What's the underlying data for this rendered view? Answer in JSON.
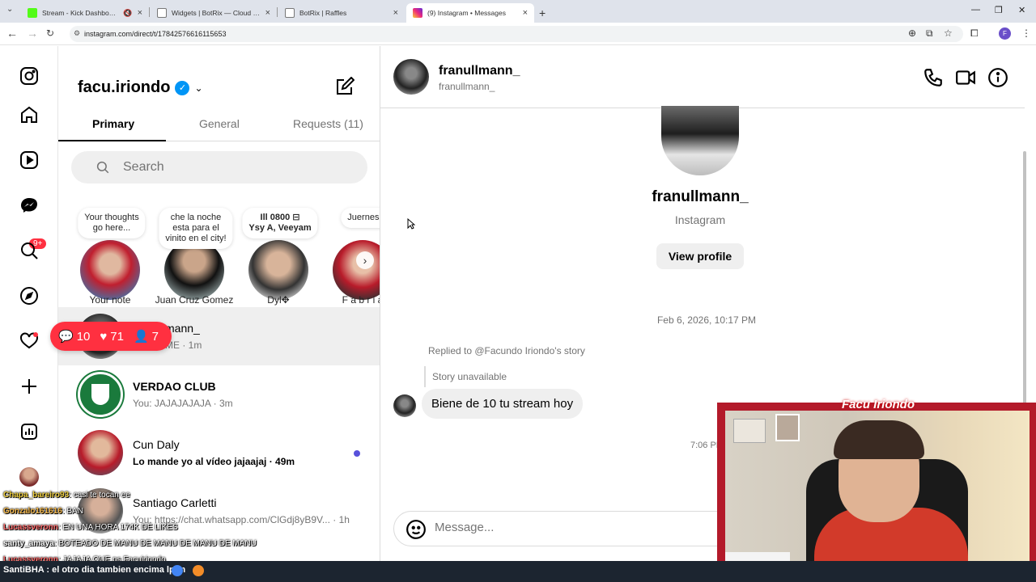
{
  "browser": {
    "tabs": [
      {
        "title": "Stream - Kick Dashboard",
        "active": false
      },
      {
        "title": "Widgets | BotRix — Cloud Strea",
        "active": false
      },
      {
        "title": "BotRix | Raffles",
        "active": false
      },
      {
        "title": "(9) Instagram • Messages",
        "active": true
      }
    ],
    "url": "instagram.com/direct/t/17842576616115653",
    "profile_initial": "F"
  },
  "rail": {
    "notification_badge": "9+"
  },
  "inbox": {
    "account": "facu.iriondo",
    "tabs": [
      "Primary",
      "General",
      "Requests (11)"
    ],
    "search_placeholder": "Search",
    "notes": [
      {
        "bubble": "Your thoughts\ngo here...",
        "name": "Your note"
      },
      {
        "bubble": "che la noche\nesta para el\nvinito en el city!",
        "name": "Juan Cruz Gomez"
      },
      {
        "bubble": "Ill 0800 ⊟\nYsy A, Veeyam",
        "name": "Dyl✥"
      },
      {
        "bubble": "Juerness ⚽",
        "name": "F a b r i a"
      }
    ],
    "threads": [
      {
        "name": "franullmann_",
        "visible_name": "mann_",
        "preview": "ME · 1m",
        "unread": false
      },
      {
        "name": "VERDAO CLUB",
        "preview": "You: JAJAJAJAJA · 3m",
        "unread": false
      },
      {
        "name": "Cun Daly",
        "preview": "Lo mande yo al vídeo jajaajaj · 49m",
        "unread": true
      },
      {
        "name": "Santiago Carletti",
        "preview": "You: https://chat.whatsapp.com/ClGdj8yB9V... · 1h",
        "unread": false
      }
    ]
  },
  "stream_notif": {
    "comments": "10",
    "likes": "71",
    "followers": "7"
  },
  "chat": {
    "header_name": "franullmann_",
    "header_username": "franullmann_",
    "profile_name": "franullmann_",
    "profile_sub": "Instagram",
    "view_profile": "View profile",
    "timestamp": "Feb 6, 2026, 10:17 PM",
    "replied": "Replied to @Facundo Iriondo's story",
    "story_unavailable": "Story unavailable",
    "message": "Biene de 10 tu stream hoy",
    "timestamp2": "7:06 PM",
    "composer_placeholder": "Message..."
  },
  "stream_overlay": {
    "cam_title": "Facu Iriondo",
    "chat_lines": [
      {
        "user": "Chapa_bareiro93",
        "text": ": casi te tocan ee"
      },
      {
        "user": "Gonzalo161616",
        "text": ": BAN"
      },
      {
        "user": "Lucassveronn",
        "text": ": EN UNA HORA 174K DE LIKES"
      },
      {
        "user": "santy_amaya",
        "text": ": BOTEADO DE MANU DE MANU DE MANU DE MANU"
      },
      {
        "user": "Lucassveronn",
        "text": ": JAJAJA QUE ps Facuiriondo"
      }
    ],
    "taskbar_text": "SantiBHA : el otro dia tambien encima lptm"
  }
}
